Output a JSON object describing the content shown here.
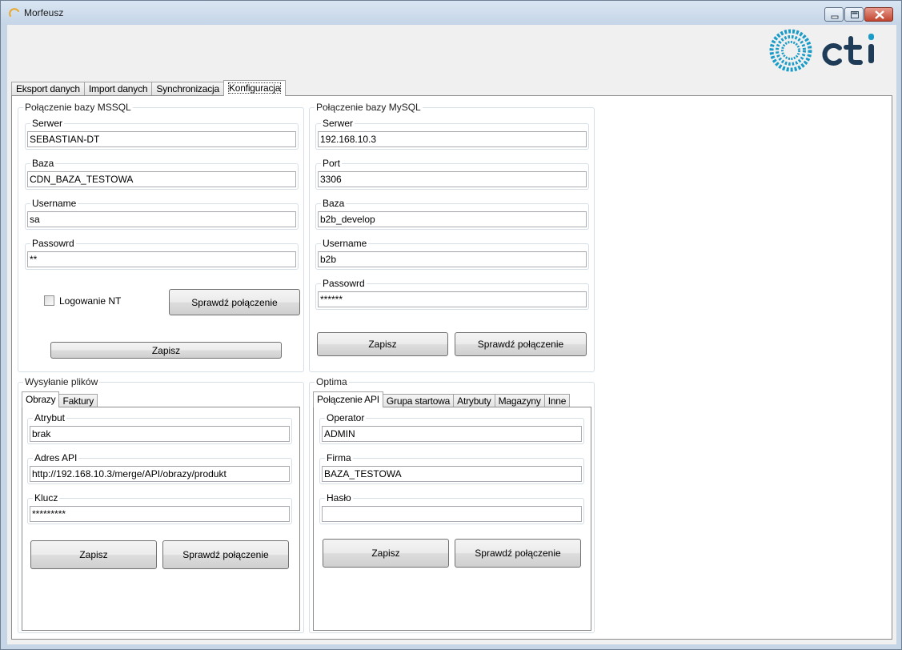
{
  "window": {
    "title": "Morfeusz"
  },
  "tabs": [
    {
      "label": "Eksport danych"
    },
    {
      "label": "Import danych"
    },
    {
      "label": "Synchronizacja"
    },
    {
      "label": "Konfiguracja"
    }
  ],
  "mssql": {
    "title": "Połączenie bazy MSSQL",
    "server_label": "Serwer",
    "server_value": "SEBASTIAN-DT",
    "db_label": "Baza",
    "db_value": "CDN_BAZA_TESTOWA",
    "user_label": "Username",
    "user_value": "sa",
    "pass_label": "Passowrd",
    "pass_value": "**",
    "nt_label": "Logowanie NT",
    "test_button": "Sprawdź połączenie",
    "save_button": "Zapisz"
  },
  "mysql": {
    "title": "Połączenie bazy MySQL",
    "server_label": "Serwer",
    "server_value": "192.168.10.3",
    "port_label": "Port",
    "port_value": "3306",
    "db_label": "Baza",
    "db_value": "b2b_develop",
    "user_label": "Username",
    "user_value": "b2b",
    "pass_label": "Passowrd",
    "pass_value": "******",
    "save_button": "Zapisz",
    "test_button": "Sprawdź połączenie"
  },
  "files": {
    "title": "Wysyłanie plików",
    "tabs": [
      {
        "label": "Obrazy"
      },
      {
        "label": "Faktury"
      }
    ],
    "attr_label": "Atrybut",
    "attr_value": "brak",
    "api_label": "Adres API",
    "api_value": "http://192.168.10.3/merge/API/obrazy/produkt",
    "key_label": "Klucz",
    "key_value": "*********",
    "save_button": "Zapisz",
    "test_button": "Sprawdź połączenie"
  },
  "optima": {
    "title": "Optima",
    "tabs": [
      {
        "label": "Połączenie API"
      },
      {
        "label": "Grupa startowa"
      },
      {
        "label": "Atrybuty"
      },
      {
        "label": "Magazyny"
      },
      {
        "label": "Inne"
      }
    ],
    "operator_label": "Operator",
    "operator_value": "ADMIN",
    "company_label": "Firma",
    "company_value": "BAZA_TESTOWA",
    "password_label": "Hasło",
    "password_value": "",
    "save_button": "Zapisz",
    "test_button": "Sprawdź połączenie"
  },
  "colors": {
    "logo_teal": "#1b9bc7",
    "logo_navy": "#1e3b57"
  },
  "icons": {
    "app": "app-spinner-icon",
    "minimize": "minimize-icon",
    "maximize": "maximize-icon",
    "close": "close-icon",
    "logo": "cti-logo"
  }
}
